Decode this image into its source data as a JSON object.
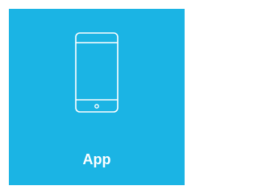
{
  "tile": {
    "label": "App",
    "icon": "smartphone-icon",
    "background_color": "#1bb4e4",
    "foreground_color": "#ffffff"
  }
}
